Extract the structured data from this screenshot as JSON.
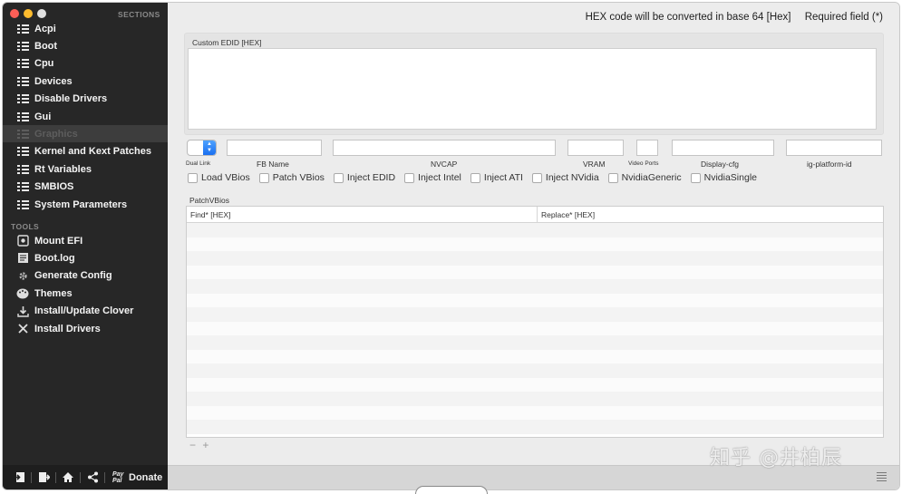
{
  "sidebar": {
    "sections_label": "SECTIONS",
    "tools_label": "TOOLS",
    "traffic_colors": [
      "#fd5f57",
      "#febc2e",
      "#e0e0e0"
    ],
    "sections": [
      {
        "label": "Acpi",
        "icon": "list-icon"
      },
      {
        "label": "Boot",
        "icon": "list-icon"
      },
      {
        "label": "Cpu",
        "icon": "list-icon"
      },
      {
        "label": "Devices",
        "icon": "list-icon"
      },
      {
        "label": "Disable Drivers",
        "icon": "list-icon"
      },
      {
        "label": "Gui",
        "icon": "list-icon"
      },
      {
        "label": "Graphics",
        "icon": "list-icon",
        "selected": true
      },
      {
        "label": "Kernel and Kext Patches",
        "icon": "list-icon"
      },
      {
        "label": "Rt Variables",
        "icon": "list-icon"
      },
      {
        "label": "SMBIOS",
        "icon": "list-icon"
      },
      {
        "label": "System Parameters",
        "icon": "list-icon"
      }
    ],
    "tools": [
      {
        "label": "Mount EFI",
        "icon": "disk-icon"
      },
      {
        "label": "Boot.log",
        "icon": "log-icon"
      },
      {
        "label": "Generate Config",
        "icon": "gear-icon"
      },
      {
        "label": "Themes",
        "icon": "palette-icon"
      },
      {
        "label": "Install/Update Clover",
        "icon": "install-icon"
      },
      {
        "label": "Install Drivers",
        "icon": "tools-icon"
      }
    ],
    "bottom": {
      "paypal_line1": "Pay",
      "paypal_line2": "Pal",
      "donate_label": "Donate"
    }
  },
  "main": {
    "hex_note": "HEX code will be converted in base 64 [Hex]",
    "required_note": "Required field (*)",
    "custom_edid_label": "Custom EDID [HEX]",
    "fields": {
      "dual_link": "Dual Link",
      "fb_name": "FB Name",
      "nvcap": "NVCAP",
      "vram": "VRAM",
      "video_ports": "Video Ports",
      "display_cfg": "Display-cfg",
      "ig_platform_id": "ig-platform-id"
    },
    "checkboxes": [
      "Load VBios",
      "Patch VBios",
      "Inject EDID",
      "Inject Intel",
      "Inject ATI",
      "Inject NVidia",
      "NvidiaGeneric",
      "NvidiaSingle"
    ],
    "patch_vbios_label": "PatchVBios",
    "table": {
      "columns": [
        "Find* [HEX]",
        "Replace* [HEX]"
      ]
    },
    "plus_minus": "− +"
  },
  "watermark": "知乎 @井柏辰"
}
